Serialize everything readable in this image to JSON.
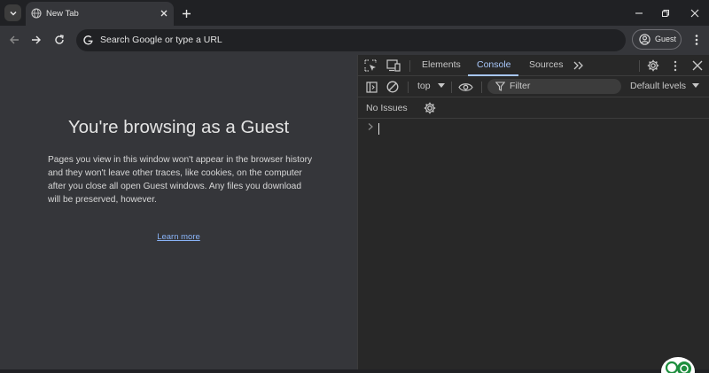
{
  "browser": {
    "tab": {
      "title": "New Tab"
    },
    "omnibox": {
      "placeholder": "Search Google or type a URL"
    },
    "profile": {
      "label": "Guest"
    }
  },
  "page": {
    "heading": "You're browsing as a Guest",
    "body": "Pages you view in this window won't appear in the browser history and they won't leave other traces, like cookies, on the computer after you close all open Guest windows. Any files you download will be preserved, however.",
    "link": "Learn more"
  },
  "devtools": {
    "tabs": [
      {
        "label": "Elements",
        "active": false
      },
      {
        "label": "Console",
        "active": true
      },
      {
        "label": "Sources",
        "active": false
      }
    ],
    "console": {
      "context": "top",
      "filter_placeholder": "Filter",
      "levels": "Default levels",
      "issues": "No Issues"
    }
  },
  "colors": {
    "accent": "#a8c7fa",
    "link": "#8ab4f8",
    "page_bg": "#35363a",
    "devtools_bg": "#282828"
  }
}
